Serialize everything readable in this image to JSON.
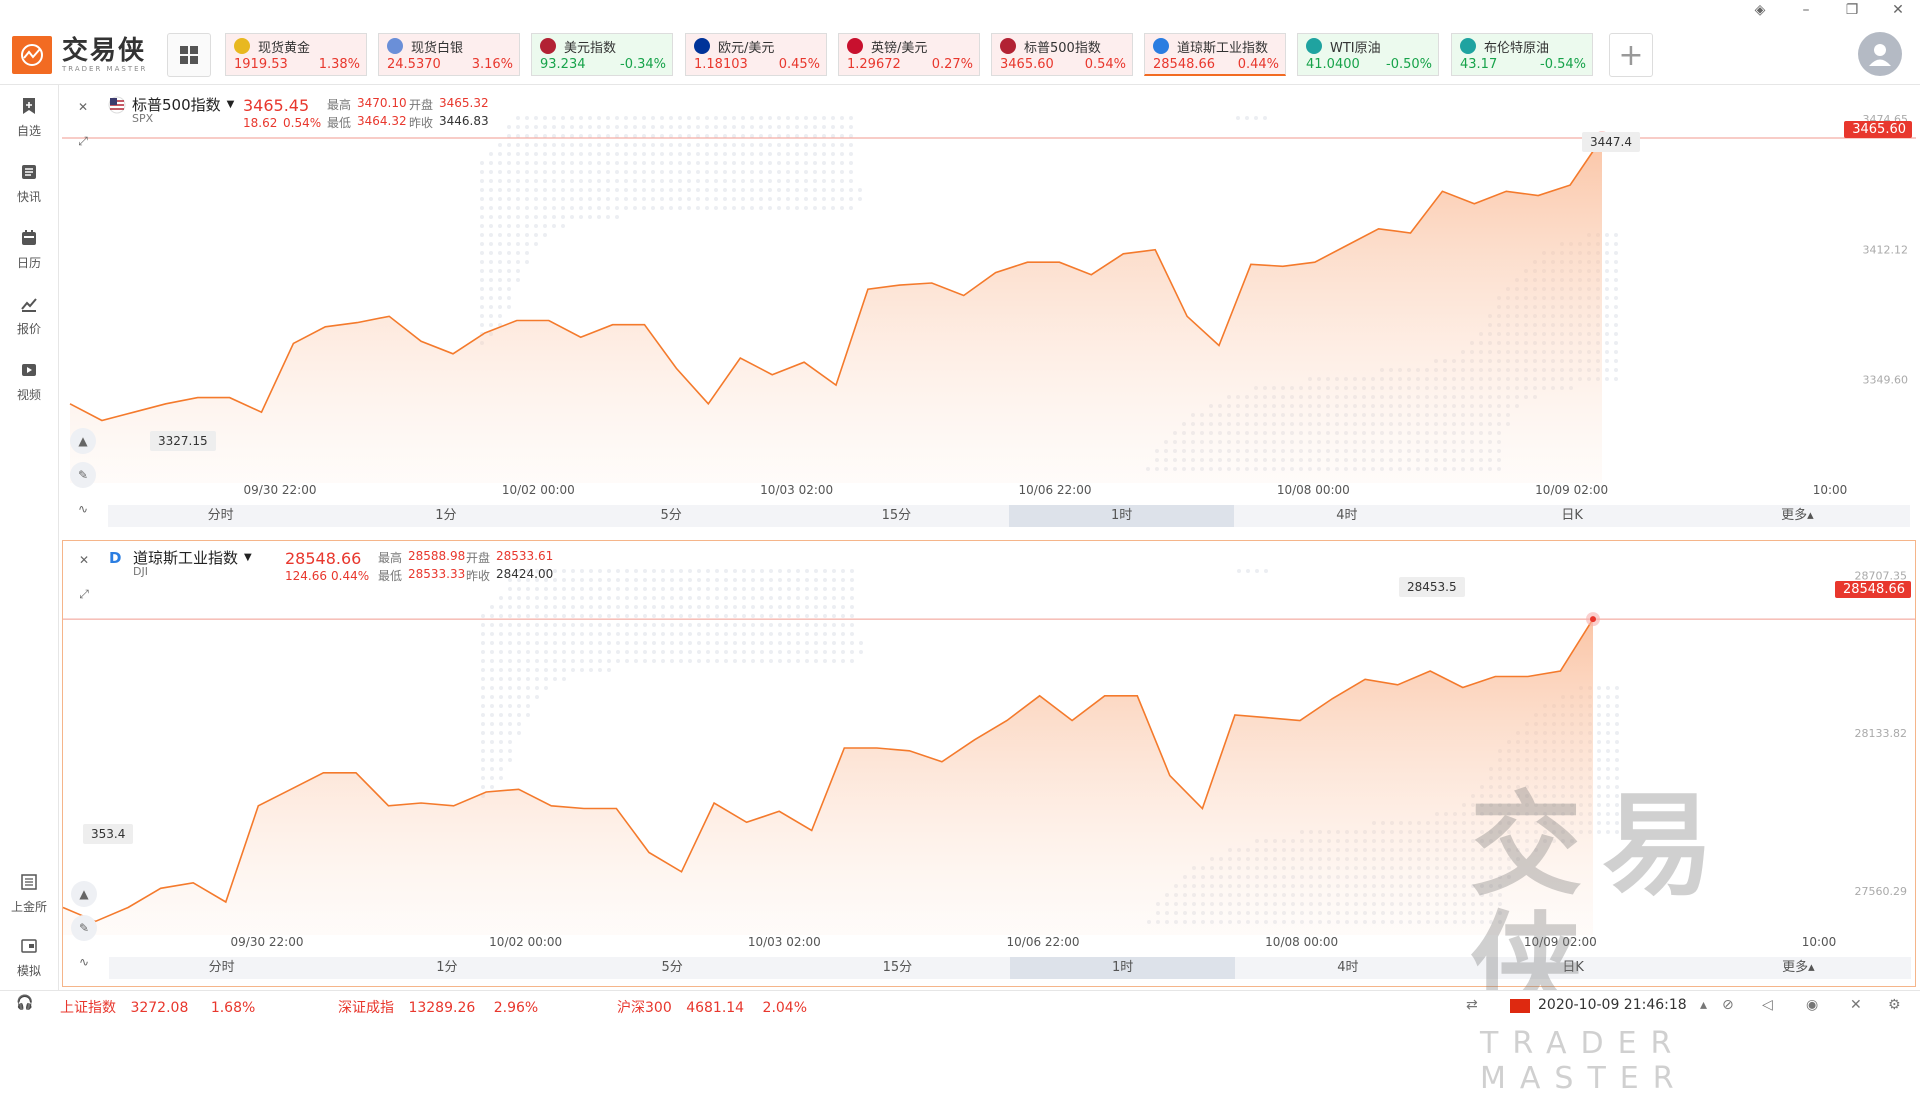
{
  "app": {
    "logo_cn": "交易侠",
    "logo_en": "TRADER MASTER",
    "watermark_cn": "交易侠",
    "watermark_en": "TRADER MASTER"
  },
  "tickers": [
    {
      "name": "现货黄金",
      "price": "1919.53",
      "change": "1.38%",
      "trend": "up",
      "icon": "gold-icon",
      "color": "#e8b820"
    },
    {
      "name": "现货白银",
      "price": "24.5370",
      "change": "3.16%",
      "trend": "up",
      "icon": "silver-icon",
      "color": "#6a8fd8"
    },
    {
      "name": "美元指数",
      "price": "93.234",
      "change": "-0.34%",
      "trend": "down",
      "icon": "us-flag-icon",
      "color": "#b22234"
    },
    {
      "name": "欧元/美元",
      "price": "1.18103",
      "change": "0.45%",
      "trend": "up",
      "icon": "eu-us-flag-icon",
      "color": "#003399"
    },
    {
      "name": "英镑/美元",
      "price": "1.29672",
      "change": "0.27%",
      "trend": "up",
      "icon": "uk-us-flag-icon",
      "color": "#c8102e"
    },
    {
      "name": "标普500指数",
      "price": "3465.60",
      "change": "0.54%",
      "trend": "up",
      "icon": "us-flag-icon",
      "color": "#b22234"
    },
    {
      "name": "道琼斯工业指数",
      "price": "28548.66",
      "change": "0.44%",
      "trend": "up",
      "icon": "dow-icon",
      "color": "#2a7de1"
    },
    {
      "name": "WTI原油",
      "price": "41.0400",
      "change": "-0.50%",
      "trend": "down",
      "icon": "oil-icon",
      "color": "#1fa3a0"
    },
    {
      "name": "布伦特原油",
      "price": "43.17",
      "change": "-0.54%",
      "trend": "down",
      "icon": "oil-icon",
      "color": "#1fa3a0"
    }
  ],
  "sidebar": {
    "items": [
      {
        "label": "自选",
        "icon": "bookmark-icon"
      },
      {
        "label": "快讯",
        "icon": "news-icon"
      },
      {
        "label": "日历",
        "icon": "calendar-icon"
      },
      {
        "label": "报价",
        "icon": "quote-chart-icon"
      },
      {
        "label": "视频",
        "icon": "video-icon"
      }
    ],
    "bottom_items": [
      {
        "label": "上金所",
        "icon": "exchange-icon"
      },
      {
        "label": "模拟",
        "icon": "simulate-icon"
      }
    ]
  },
  "labels": {
    "high": "最高",
    "open": "开盘",
    "low": "最低",
    "prev_close": "昨收"
  },
  "timeframes": [
    "分时",
    "1分",
    "5分",
    "15分",
    "1时",
    "4时",
    "日K",
    "更多"
  ],
  "selected_timeframe": "1时",
  "panels": [
    {
      "name": "标普500指数",
      "symbol": "SPX",
      "price": "3465.45",
      "change": "18.62",
      "change_pct": "0.54%",
      "high": "3470.10",
      "open": "3465.32",
      "low": "3464.32",
      "prev_close": "3446.83",
      "current_tag": "3465.60",
      "max_tip": "3447.4",
      "min_tip": "3327.15"
    },
    {
      "name": "道琼斯工业指数",
      "symbol": "DJI",
      "price": "28548.66",
      "change": "124.66",
      "change_pct": "0.44%",
      "high": "28588.98",
      "open": "28533.61",
      "low": "28533.33",
      "prev_close": "28424.00",
      "current_tag": "28548.66",
      "max_tip": "28453.5",
      "min_tip": "353.4"
    }
  ],
  "chart_data": [
    {
      "type": "area",
      "title": "标普500指数",
      "x_ticks": [
        "09/30 22:00",
        "10/02 00:00",
        "10/03 02:00",
        "10/06 22:00",
        "10/08 00:00",
        "10/09 02:00",
        "10:00"
      ],
      "y_ticks": [
        3474.65,
        3412.12,
        3349.6
      ],
      "ylim": [
        3300,
        3480
      ],
      "values": [
        3338,
        3330,
        3334,
        3338,
        3341,
        3341,
        3334,
        3367,
        3375,
        3377,
        3380,
        3368,
        3362,
        3372,
        3378,
        3378,
        3370,
        3376,
        3376,
        3355,
        3338,
        3360,
        3352,
        3358,
        3347,
        3393,
        3395,
        3396,
        3390,
        3401,
        3406,
        3406,
        3400,
        3410,
        3412,
        3380,
        3366,
        3405,
        3404,
        3406,
        3414,
        3422,
        3420,
        3440,
        3434,
        3440,
        3438,
        3443,
        3465.6
      ]
    },
    {
      "type": "area",
      "title": "道琼斯工业指数",
      "x_ticks": [
        "09/30 22:00",
        "10/02 00:00",
        "10/03 02:00",
        "10/06 22:00",
        "10/08 00:00",
        "10/09 02:00",
        "10:00"
      ],
      "y_ticks": [
        28707.35,
        28133.82,
        27560.29
      ],
      "ylim": [
        27400,
        28760
      ],
      "values": [
        27500,
        27450,
        27500,
        27570,
        27590,
        27520,
        27870,
        27930,
        27990,
        27990,
        27870,
        27880,
        27870,
        27920,
        27930,
        27870,
        27860,
        27860,
        27700,
        27630,
        27880,
        27810,
        27850,
        27780,
        28080,
        28080,
        28070,
        28030,
        28110,
        28180,
        28270,
        28180,
        28270,
        28270,
        27980,
        27860,
        28200,
        28190,
        28180,
        28260,
        28330,
        28310,
        28360,
        28300,
        28340,
        28340,
        28360,
        28548.66
      ]
    }
  ],
  "bottom": {
    "indices": [
      {
        "name": "上证指数",
        "value": "3272.08",
        "pct": "1.68%"
      },
      {
        "name": "深证成指",
        "value": "13289.26",
        "pct": "2.96%"
      },
      {
        "name": "沪深300",
        "value": "4681.14",
        "pct": "2.04%"
      }
    ],
    "datetime": "2020-10-09 21:46:18"
  }
}
